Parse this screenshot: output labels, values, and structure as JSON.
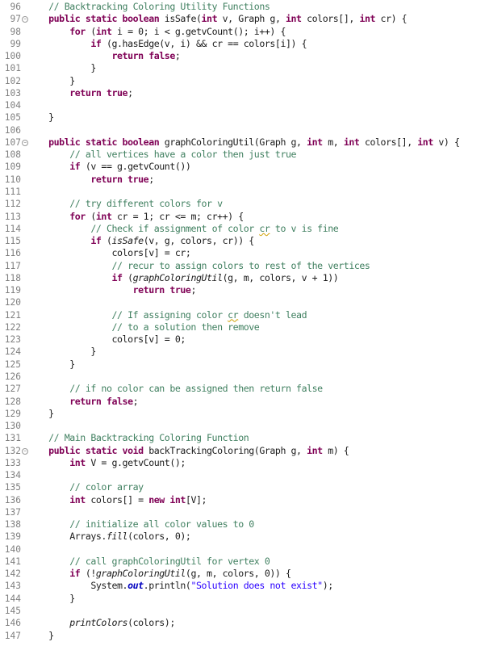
{
  "editor": {
    "language": "java",
    "colors": {
      "keyword": "#7f0055",
      "comment": "#3f7f5f",
      "string": "#2a00ff",
      "line_number": "#7f7f7f"
    },
    "lines": [
      {
        "n": "96",
        "fold": false,
        "tokens": [
          [
            "    ",
            ""
          ],
          [
            "// Backtracking Coloring Utility Functions",
            "cm"
          ]
        ]
      },
      {
        "n": "97",
        "fold": true,
        "tokens": [
          [
            "    ",
            ""
          ],
          [
            "public static boolean",
            "kw"
          ],
          [
            " isSafe(",
            ""
          ],
          [
            "int",
            "kw"
          ],
          [
            " v, Graph g, ",
            ""
          ],
          [
            "int",
            "kw"
          ],
          [
            " colors[], ",
            ""
          ],
          [
            "int",
            "kw"
          ],
          [
            " cr) {",
            ""
          ]
        ]
      },
      {
        "n": "98",
        "fold": false,
        "tokens": [
          [
            "        ",
            ""
          ],
          [
            "for",
            "kw"
          ],
          [
            " (",
            ""
          ],
          [
            "int",
            "kw"
          ],
          [
            " i = 0; i < g.getvCount(); i++) {",
            ""
          ]
        ]
      },
      {
        "n": "99",
        "fold": false,
        "tokens": [
          [
            "            ",
            ""
          ],
          [
            "if",
            "kw"
          ],
          [
            " (g.hasEdge(v, i) && cr == colors[i]) {",
            ""
          ]
        ]
      },
      {
        "n": "100",
        "fold": false,
        "tokens": [
          [
            "                ",
            ""
          ],
          [
            "return false",
            "kw"
          ],
          [
            ";",
            ""
          ]
        ]
      },
      {
        "n": "101",
        "fold": false,
        "tokens": [
          [
            "            }",
            ""
          ]
        ]
      },
      {
        "n": "102",
        "fold": false,
        "tokens": [
          [
            "        }",
            ""
          ]
        ]
      },
      {
        "n": "103",
        "fold": false,
        "tokens": [
          [
            "        ",
            ""
          ],
          [
            "return true",
            "kw"
          ],
          [
            ";",
            ""
          ]
        ]
      },
      {
        "n": "104",
        "fold": false,
        "tokens": []
      },
      {
        "n": "105",
        "fold": false,
        "tokens": [
          [
            "    }",
            ""
          ]
        ]
      },
      {
        "n": "106",
        "fold": false,
        "tokens": []
      },
      {
        "n": "107",
        "fold": true,
        "tokens": [
          [
            "    ",
            ""
          ],
          [
            "public static boolean",
            "kw"
          ],
          [
            " graphColoringUtil(Graph g, ",
            ""
          ],
          [
            "int",
            "kw"
          ],
          [
            " m, ",
            ""
          ],
          [
            "int",
            "kw"
          ],
          [
            " colors[], ",
            ""
          ],
          [
            "int",
            "kw"
          ],
          [
            " v) {",
            ""
          ]
        ]
      },
      {
        "n": "108",
        "fold": false,
        "tokens": [
          [
            "        ",
            ""
          ],
          [
            "// all vertices have a color then just true",
            "cm"
          ]
        ]
      },
      {
        "n": "109",
        "fold": false,
        "tokens": [
          [
            "        ",
            ""
          ],
          [
            "if",
            "kw"
          ],
          [
            " (v == g.getvCount())",
            ""
          ]
        ]
      },
      {
        "n": "110",
        "fold": false,
        "tokens": [
          [
            "            ",
            ""
          ],
          [
            "return true",
            "kw"
          ],
          [
            ";",
            ""
          ]
        ]
      },
      {
        "n": "111",
        "fold": false,
        "tokens": []
      },
      {
        "n": "112",
        "fold": false,
        "tokens": [
          [
            "        ",
            ""
          ],
          [
            "// try different colors for v",
            "cm"
          ]
        ]
      },
      {
        "n": "113",
        "fold": false,
        "tokens": [
          [
            "        ",
            ""
          ],
          [
            "for",
            "kw"
          ],
          [
            " (",
            ""
          ],
          [
            "int",
            "kw"
          ],
          [
            " cr = 1; cr <= m; cr++) {",
            ""
          ]
        ]
      },
      {
        "n": "114",
        "fold": false,
        "tokens": [
          [
            "            ",
            ""
          ],
          [
            "// Check if assignment of color ",
            "cm"
          ],
          [
            "cr",
            "cm sq"
          ],
          [
            " to v is fine",
            "cm"
          ]
        ]
      },
      {
        "n": "115",
        "fold": false,
        "tokens": [
          [
            "            ",
            ""
          ],
          [
            "if",
            "kw"
          ],
          [
            " (",
            ""
          ],
          [
            "isSafe",
            "it"
          ],
          [
            "(v, g, colors, cr)) {",
            ""
          ]
        ]
      },
      {
        "n": "116",
        "fold": false,
        "tokens": [
          [
            "                colors[v] = cr;",
            ""
          ]
        ]
      },
      {
        "n": "117",
        "fold": false,
        "tokens": [
          [
            "                ",
            ""
          ],
          [
            "// recur to assign colors to rest of the vertices",
            "cm"
          ]
        ]
      },
      {
        "n": "118",
        "fold": false,
        "tokens": [
          [
            "                ",
            ""
          ],
          [
            "if",
            "kw"
          ],
          [
            " (",
            ""
          ],
          [
            "graphColoringUtil",
            "it"
          ],
          [
            "(g, m, colors, v + 1))",
            ""
          ]
        ]
      },
      {
        "n": "119",
        "fold": false,
        "tokens": [
          [
            "                    ",
            ""
          ],
          [
            "return true",
            "kw"
          ],
          [
            ";",
            ""
          ]
        ]
      },
      {
        "n": "120",
        "fold": false,
        "tokens": []
      },
      {
        "n": "121",
        "fold": false,
        "tokens": [
          [
            "                ",
            ""
          ],
          [
            "// If assigning color ",
            "cm"
          ],
          [
            "cr",
            "cm sq"
          ],
          [
            " doesn't lead",
            "cm"
          ]
        ]
      },
      {
        "n": "122",
        "fold": false,
        "tokens": [
          [
            "                ",
            ""
          ],
          [
            "// to a solution then remove",
            "cm"
          ]
        ]
      },
      {
        "n": "123",
        "fold": false,
        "tokens": [
          [
            "                colors[v] = 0;",
            ""
          ]
        ]
      },
      {
        "n": "124",
        "fold": false,
        "tokens": [
          [
            "            }",
            ""
          ]
        ]
      },
      {
        "n": "125",
        "fold": false,
        "tokens": [
          [
            "        }",
            ""
          ]
        ]
      },
      {
        "n": "126",
        "fold": false,
        "tokens": []
      },
      {
        "n": "127",
        "fold": false,
        "tokens": [
          [
            "        ",
            ""
          ],
          [
            "// if no color can be assigned then return false",
            "cm"
          ]
        ]
      },
      {
        "n": "128",
        "fold": false,
        "tokens": [
          [
            "        ",
            ""
          ],
          [
            "return false",
            "kw"
          ],
          [
            ";",
            ""
          ]
        ]
      },
      {
        "n": "129",
        "fold": false,
        "tokens": [
          [
            "    }",
            ""
          ]
        ]
      },
      {
        "n": "130",
        "fold": false,
        "tokens": []
      },
      {
        "n": "131",
        "fold": false,
        "tokens": [
          [
            "    ",
            ""
          ],
          [
            "// Main Backtracking Coloring Function",
            "cm"
          ]
        ]
      },
      {
        "n": "132",
        "fold": true,
        "tokens": [
          [
            "    ",
            ""
          ],
          [
            "public static void",
            "kw"
          ],
          [
            " backTrackingColoring(Graph g, ",
            ""
          ],
          [
            "int",
            "kw"
          ],
          [
            " m) {",
            ""
          ]
        ]
      },
      {
        "n": "133",
        "fold": false,
        "tokens": [
          [
            "        ",
            ""
          ],
          [
            "int",
            "kw"
          ],
          [
            " V = g.getvCount();",
            ""
          ]
        ]
      },
      {
        "n": "134",
        "fold": false,
        "tokens": []
      },
      {
        "n": "135",
        "fold": false,
        "tokens": [
          [
            "        ",
            ""
          ],
          [
            "// color array",
            "cm"
          ]
        ]
      },
      {
        "n": "136",
        "fold": false,
        "tokens": [
          [
            "        ",
            ""
          ],
          [
            "int",
            "kw"
          ],
          [
            " colors[] = ",
            ""
          ],
          [
            "new int",
            "kw"
          ],
          [
            "[V];",
            ""
          ]
        ]
      },
      {
        "n": "137",
        "fold": false,
        "tokens": []
      },
      {
        "n": "138",
        "fold": false,
        "tokens": [
          [
            "        ",
            ""
          ],
          [
            "// initialize all color values to 0",
            "cm"
          ]
        ]
      },
      {
        "n": "139",
        "fold": false,
        "tokens": [
          [
            "        Arrays.",
            ""
          ],
          [
            "fill",
            "it"
          ],
          [
            "(colors, 0);",
            ""
          ]
        ]
      },
      {
        "n": "140",
        "fold": false,
        "tokens": []
      },
      {
        "n": "141",
        "fold": false,
        "tokens": [
          [
            "        ",
            ""
          ],
          [
            "// call graphColoringUtil for vertex 0",
            "cm"
          ]
        ]
      },
      {
        "n": "142",
        "fold": false,
        "tokens": [
          [
            "        ",
            ""
          ],
          [
            "if",
            "kw"
          ],
          [
            " (!",
            ""
          ],
          [
            "graphColoringUtil",
            "it"
          ],
          [
            "(g, m, colors, 0)) {",
            ""
          ]
        ]
      },
      {
        "n": "143",
        "fold": false,
        "tokens": [
          [
            "            System.",
            ""
          ],
          [
            "out",
            "fld"
          ],
          [
            ".println(",
            ""
          ],
          [
            "\"Solution does not exist\"",
            "st"
          ],
          [
            ");",
            ""
          ]
        ]
      },
      {
        "n": "144",
        "fold": false,
        "tokens": [
          [
            "        }",
            ""
          ]
        ]
      },
      {
        "n": "145",
        "fold": false,
        "tokens": []
      },
      {
        "n": "146",
        "fold": false,
        "tokens": [
          [
            "        ",
            ""
          ],
          [
            "printColors",
            "it"
          ],
          [
            "(colors);",
            ""
          ]
        ]
      },
      {
        "n": "147",
        "fold": false,
        "tokens": [
          [
            "    }",
            ""
          ]
        ]
      }
    ]
  }
}
